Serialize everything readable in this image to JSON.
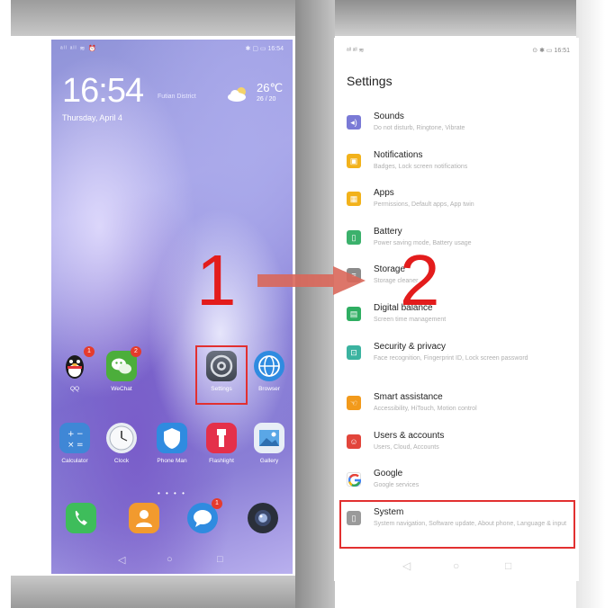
{
  "home": {
    "status_left": "ᵃˡˡ ᵃˡˡ ≋ ⏰",
    "status_right": "✱ ▢ ▭ 16:54",
    "time": "16:54",
    "location": "Futian District",
    "date": "Thursday, April 4",
    "weather_temp": "26℃",
    "weather_range": "26 / 20",
    "apps_row1": [
      {
        "label": "QQ",
        "icon": "qq-icon",
        "badge": "1"
      },
      {
        "label": "WeChat",
        "icon": "wechat-icon",
        "badge": "2"
      },
      {
        "label": "Settings",
        "icon": "settings-gear-icon",
        "badge": ""
      },
      {
        "label": "Browser",
        "icon": "browser-globe-icon",
        "badge": ""
      }
    ],
    "apps_row2": [
      {
        "label": "Calculator",
        "icon": "calculator-icon"
      },
      {
        "label": "Clock",
        "icon": "clock-icon"
      },
      {
        "label": "Phone Man",
        "icon": "shield-icon"
      },
      {
        "label": "Flashlight",
        "icon": "flashlight-icon"
      },
      {
        "label": "Gallery",
        "icon": "gallery-icon"
      }
    ],
    "dock": [
      {
        "icon": "phone-icon"
      },
      {
        "icon": "contacts-icon"
      },
      {
        "icon": "messages-icon",
        "badge": "1"
      },
      {
        "icon": "camera-icon"
      }
    ],
    "page_dots": "• • • •",
    "nav": [
      "◁",
      "○",
      "□"
    ]
  },
  "annotations": {
    "step1": "1",
    "step2": "2",
    "highlight_color": "#e23030",
    "arrow_color": "#d9675a"
  },
  "settings": {
    "status_left": "ᵃˡˡ ᵃˡˡ ≋",
    "status_right": "⊙ ✱ ▭ 16:51",
    "title": "Settings",
    "items": [
      {
        "title": "Sounds",
        "subtitle": "Do not disturb, Ringtone, Vibrate",
        "icon": "sound-icon",
        "color": "#7a7ad6"
      },
      {
        "title": "Notifications",
        "subtitle": "Badges, Lock screen notifications",
        "icon": "notifications-icon",
        "color": "#f2b21b"
      },
      {
        "title": "Apps",
        "subtitle": "Permissions, Default apps, App twin",
        "icon": "apps-icon",
        "color": "#f2b21b"
      },
      {
        "title": "Battery",
        "subtitle": "Power saving mode, Battery usage",
        "icon": "battery-icon",
        "color": "#3bb16c"
      },
      {
        "title": "Storage",
        "subtitle": "Storage cleaner",
        "icon": "storage-icon",
        "color": "#8b8b8b"
      },
      {
        "title": "Digital balance",
        "subtitle": "Screen time management",
        "icon": "digital-balance-icon",
        "color": "#2fae62"
      },
      {
        "title": "Security & privacy",
        "subtitle": "Face recognition, Fingerprint ID, Lock screen password",
        "icon": "security-icon",
        "color": "#3bb3a0"
      },
      {
        "title": "Smart assistance",
        "subtitle": "Accessibility, HiTouch, Motion control",
        "icon": "smart-assistance-icon",
        "color": "#f29a1b"
      },
      {
        "title": "Users & accounts",
        "subtitle": "Users, Cloud, Accounts",
        "icon": "users-icon",
        "color": "#e2453b"
      },
      {
        "title": "Google",
        "subtitle": "Google services",
        "icon": "google-icon",
        "color": "#ffffff"
      },
      {
        "title": "System",
        "subtitle": "System navigation, Software update, About phone, Language & input",
        "icon": "system-icon",
        "color": "#9a9a9a"
      }
    ],
    "nav": [
      "◁",
      "○",
      "□"
    ]
  }
}
